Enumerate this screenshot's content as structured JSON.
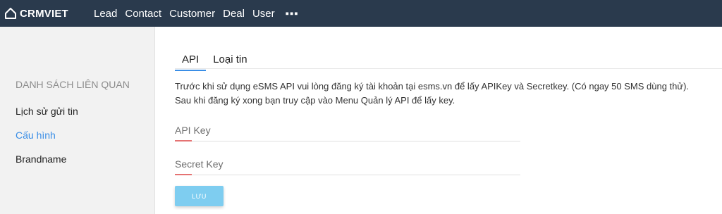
{
  "header": {
    "logo_text": "CRMVIET",
    "logo_icon": "house-icon",
    "nav": [
      "Lead",
      "Contact",
      "Customer",
      "Deal",
      "User"
    ],
    "more_label": "▪▪▪"
  },
  "sidebar": {
    "title": "DANH SÁCH LIÊN QUAN",
    "items": [
      {
        "label": "Lịch sử gửi tin",
        "active": false
      },
      {
        "label": "Cấu hình",
        "active": true
      },
      {
        "label": "Brandname",
        "active": false
      }
    ]
  },
  "tabs": [
    {
      "label": "API",
      "active": true
    },
    {
      "label": "Loại tin",
      "active": false
    }
  ],
  "description": {
    "line1": "Trước khi sử dụng eSMS API vui lòng đăng ký tài khoản tại esms.vn để lấy APIKey và Secretkey. (Có ngay 50 SMS dùng thử).",
    "line2": "Sau khi đăng ký xong bạn truy cập vào Menu Quản lý API để lấy key."
  },
  "form": {
    "api_key": {
      "placeholder": "API Key",
      "value": ""
    },
    "secret_key": {
      "placeholder": "Secret Key",
      "value": ""
    },
    "save_label": "LƯU"
  },
  "colors": {
    "topbar": "#2a3a4d",
    "accent": "#3a8ee6",
    "button": "#7ecdf0",
    "field_accent": "#e57373"
  }
}
